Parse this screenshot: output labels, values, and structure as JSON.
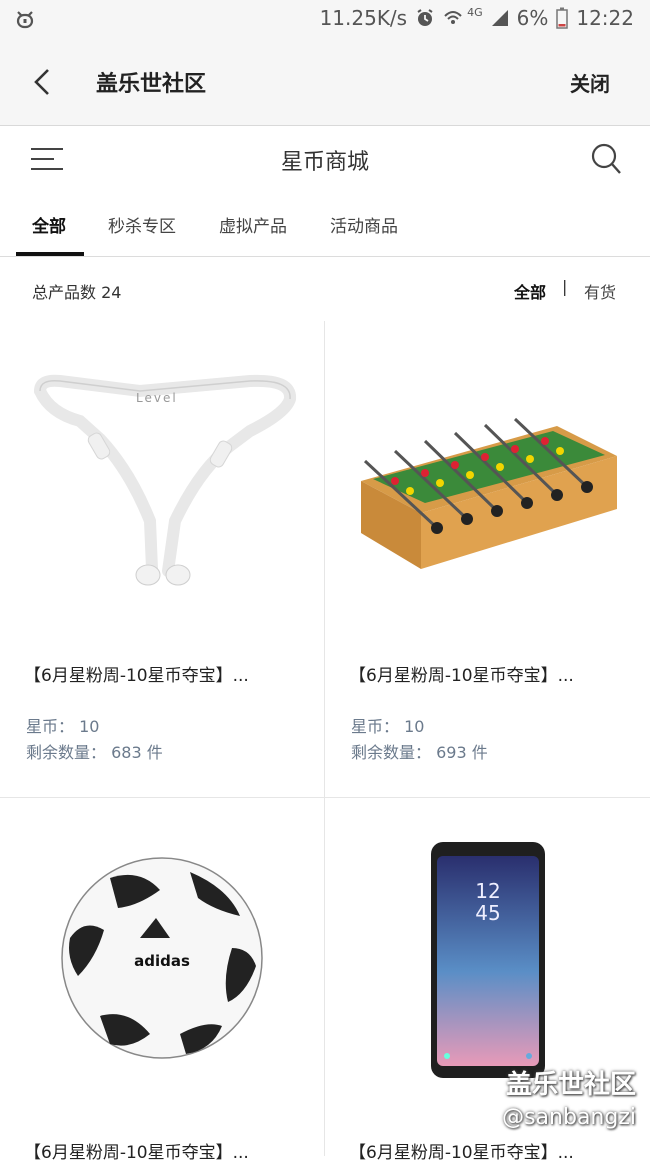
{
  "status_bar": {
    "speed": "11.25K/s",
    "network": "4G",
    "battery": "6%",
    "time": "12:22"
  },
  "header": {
    "title": "盖乐世社区",
    "close_label": "关闭"
  },
  "store": {
    "title": "星币商城"
  },
  "tabs": [
    {
      "label": "全部",
      "active": true
    },
    {
      "label": "秒杀专区",
      "active": false
    },
    {
      "label": "虚拟产品",
      "active": false
    },
    {
      "label": "活动商品",
      "active": false
    }
  ],
  "filter": {
    "total_label": "总产品数 24",
    "all_label": "全部",
    "separator": "|",
    "in_stock_label": "有货"
  },
  "products": [
    {
      "title": "【6月星粉周-10星币夺宝】...",
      "coins": "星币： 10",
      "stock": "剩余数量： 683 件",
      "image": "neckband-earphones"
    },
    {
      "title": "【6月星粉周-10星币夺宝】...",
      "coins": "星币： 10",
      "stock": "剩余数量： 693 件",
      "image": "foosball-table"
    },
    {
      "title": "【6月星粉周-10星币夺宝】...",
      "coins": "",
      "stock": "",
      "image": "soccer-ball"
    },
    {
      "title": "【6月星粉周-10星币夺宝】...",
      "coins": "",
      "stock": "",
      "image": "smartphone"
    }
  ],
  "product_image_text": {
    "earphone_brand": "Level",
    "ball_brand": "adidas",
    "phone_time_hour": "12",
    "phone_time_min": "45"
  },
  "watermark": {
    "name": "盖乐世社区",
    "handle": "@sanbangzi"
  },
  "colors": {
    "header_bg": "#f6f6f6",
    "meta_text": "#6b7a8c",
    "tab_active": "#111111"
  }
}
